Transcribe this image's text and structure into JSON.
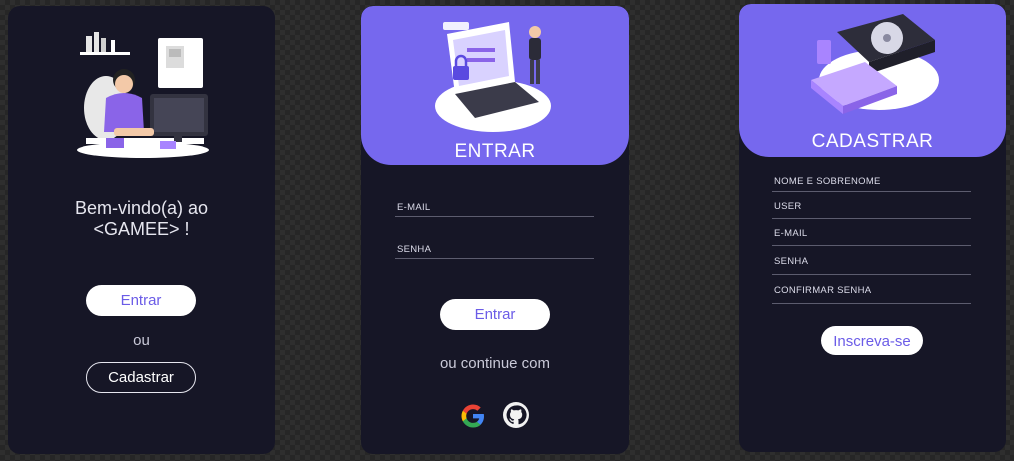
{
  "welcome": {
    "line1": "Bem-vindo(a) ao",
    "line2": "<GAMEE> !",
    "login_button": "Entrar",
    "or_text": "ou",
    "register_button": "Cadastrar"
  },
  "login": {
    "title": "ENTRAR",
    "email_label": "E-MAIL",
    "password_label": "SENHA",
    "submit_button": "Entrar",
    "alt_text": "ou continue com",
    "social": [
      "google-icon",
      "github-icon"
    ]
  },
  "register": {
    "title": "CADASTRAR",
    "fields": [
      "NOME E SOBRENOME",
      "USER",
      "E-MAIL",
      "SENHA",
      "CONFIRMAR SENHA"
    ],
    "submit_button": "Inscreva-se"
  },
  "colors": {
    "accent": "#7668ee",
    "panel": "#161626",
    "button_text": "#6b5ce7"
  }
}
